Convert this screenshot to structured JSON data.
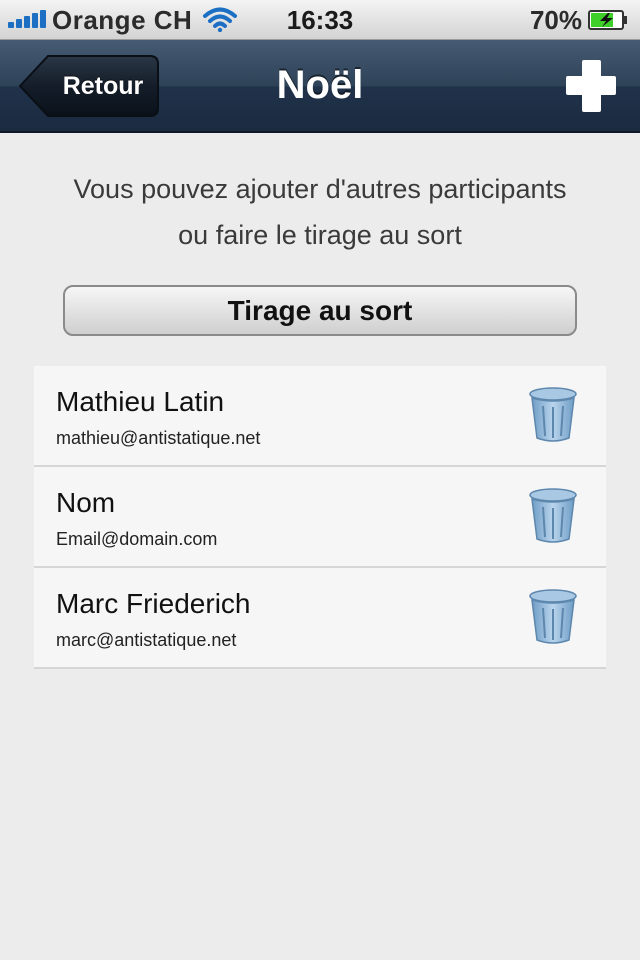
{
  "status_bar": {
    "carrier": "Orange CH",
    "time": "16:33",
    "battery_percent": "70%",
    "signal_bars": 5,
    "icons": [
      "signal-bars-icon",
      "wifi-icon",
      "battery-charging-icon"
    ]
  },
  "nav": {
    "back_label": "Retour",
    "title": "Noël",
    "add_icon": "plus-icon"
  },
  "instructions": {
    "line1": "Vous pouvez ajouter d'autres participants",
    "line2": "ou faire le tirage au sort"
  },
  "draw_button": {
    "label": "Tirage au sort"
  },
  "participants": [
    {
      "name": "Mathieu Latin",
      "email": "mathieu@antistatique.net"
    },
    {
      "name": "Nom",
      "email": "Email@domain.com"
    },
    {
      "name": "Marc Friederich",
      "email": "marc@antistatique.net"
    }
  ],
  "colors": {
    "nav_dark": "#1b2b40",
    "nav_light": "#465b73",
    "signal_blue": "#1d6fc4",
    "battery_green": "#3fcf2a",
    "trash_blue": "#8fb6d8",
    "background": "#ececec"
  }
}
